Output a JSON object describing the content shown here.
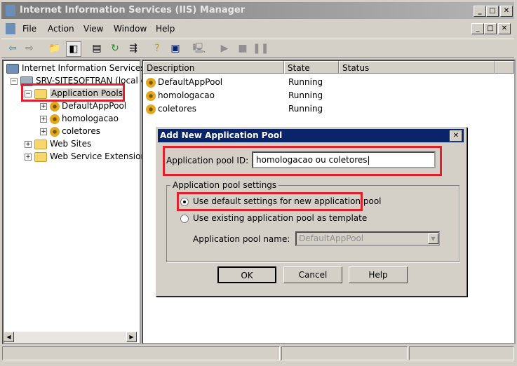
{
  "window": {
    "title": "Internet Information Services (IIS) Manager"
  },
  "menu": [
    "File",
    "Action",
    "View",
    "Window",
    "Help"
  ],
  "tree": {
    "root": "Internet Information Services",
    "server": "SRV-SITESOFTRAN (local c",
    "pools": "Application Pools",
    "pool_items": [
      "DefaultAppPool",
      "homologacao",
      "coletores"
    ],
    "websites": "Web Sites",
    "extensions": "Web Service Extension"
  },
  "list": {
    "columns": [
      "Description",
      "State",
      "Status"
    ],
    "rows": [
      {
        "description": "DefaultAppPool",
        "state": "Running",
        "status": ""
      },
      {
        "description": "homologacao",
        "state": "Running",
        "status": ""
      },
      {
        "description": "coletores",
        "state": "Running",
        "status": ""
      }
    ]
  },
  "dialog": {
    "title": "Add New Application Pool",
    "id_label": "Application pool ID:",
    "id_value": "homologacao ou coletores",
    "group_label": "Application pool settings",
    "radio_default": "Use default settings for new application pool",
    "radio_existing": "Use existing application pool as template",
    "pool_name_label": "Application pool name:",
    "pool_name_value": "DefaultAppPool",
    "ok": "OK",
    "cancel": "Cancel",
    "help": "Help"
  }
}
